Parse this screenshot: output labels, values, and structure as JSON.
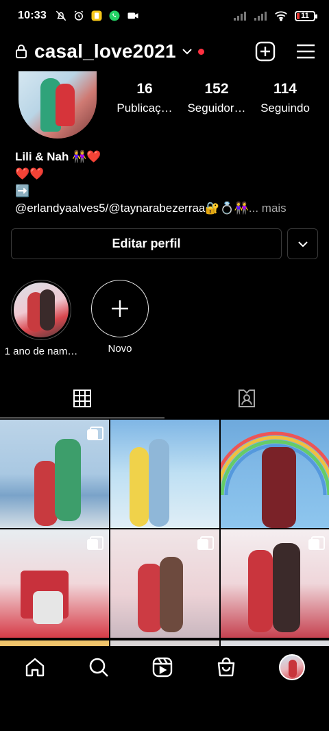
{
  "status_bar": {
    "time": "10:33",
    "battery": "11"
  },
  "top_bar": {
    "username": "casal_love2021"
  },
  "stats": [
    {
      "count": "16",
      "label": "Publicaç…"
    },
    {
      "count": "152",
      "label": "Seguidor…"
    },
    {
      "count": "114",
      "label": "Seguindo"
    }
  ],
  "bio": {
    "name": "Lili & Nah 👭❤️",
    "line2": "❤️❤️",
    "line3": "➡️",
    "line4": "@erlandyaalves5/@taynarabezerraa🔐💍👭",
    "more": "... mais"
  },
  "buttons": {
    "edit_profile": "Editar perfil"
  },
  "highlights": [
    {
      "caption": "1 ano de nam…"
    },
    {
      "caption": "Novo"
    }
  ],
  "colors": {
    "background": "#000000",
    "notification_dot": "#ff3040",
    "button_border": "#3a3a3a",
    "muted_text": "#a8a8a8"
  },
  "icons": {
    "top_bar": [
      "lock-icon",
      "chevron-down-icon",
      "create-post-icon",
      "menu-icon"
    ],
    "tabs": [
      "grid-icon",
      "tagged-icon"
    ],
    "bottom_nav": [
      "home-icon",
      "search-icon",
      "reels-icon",
      "shop-icon",
      "profile-avatar"
    ]
  }
}
